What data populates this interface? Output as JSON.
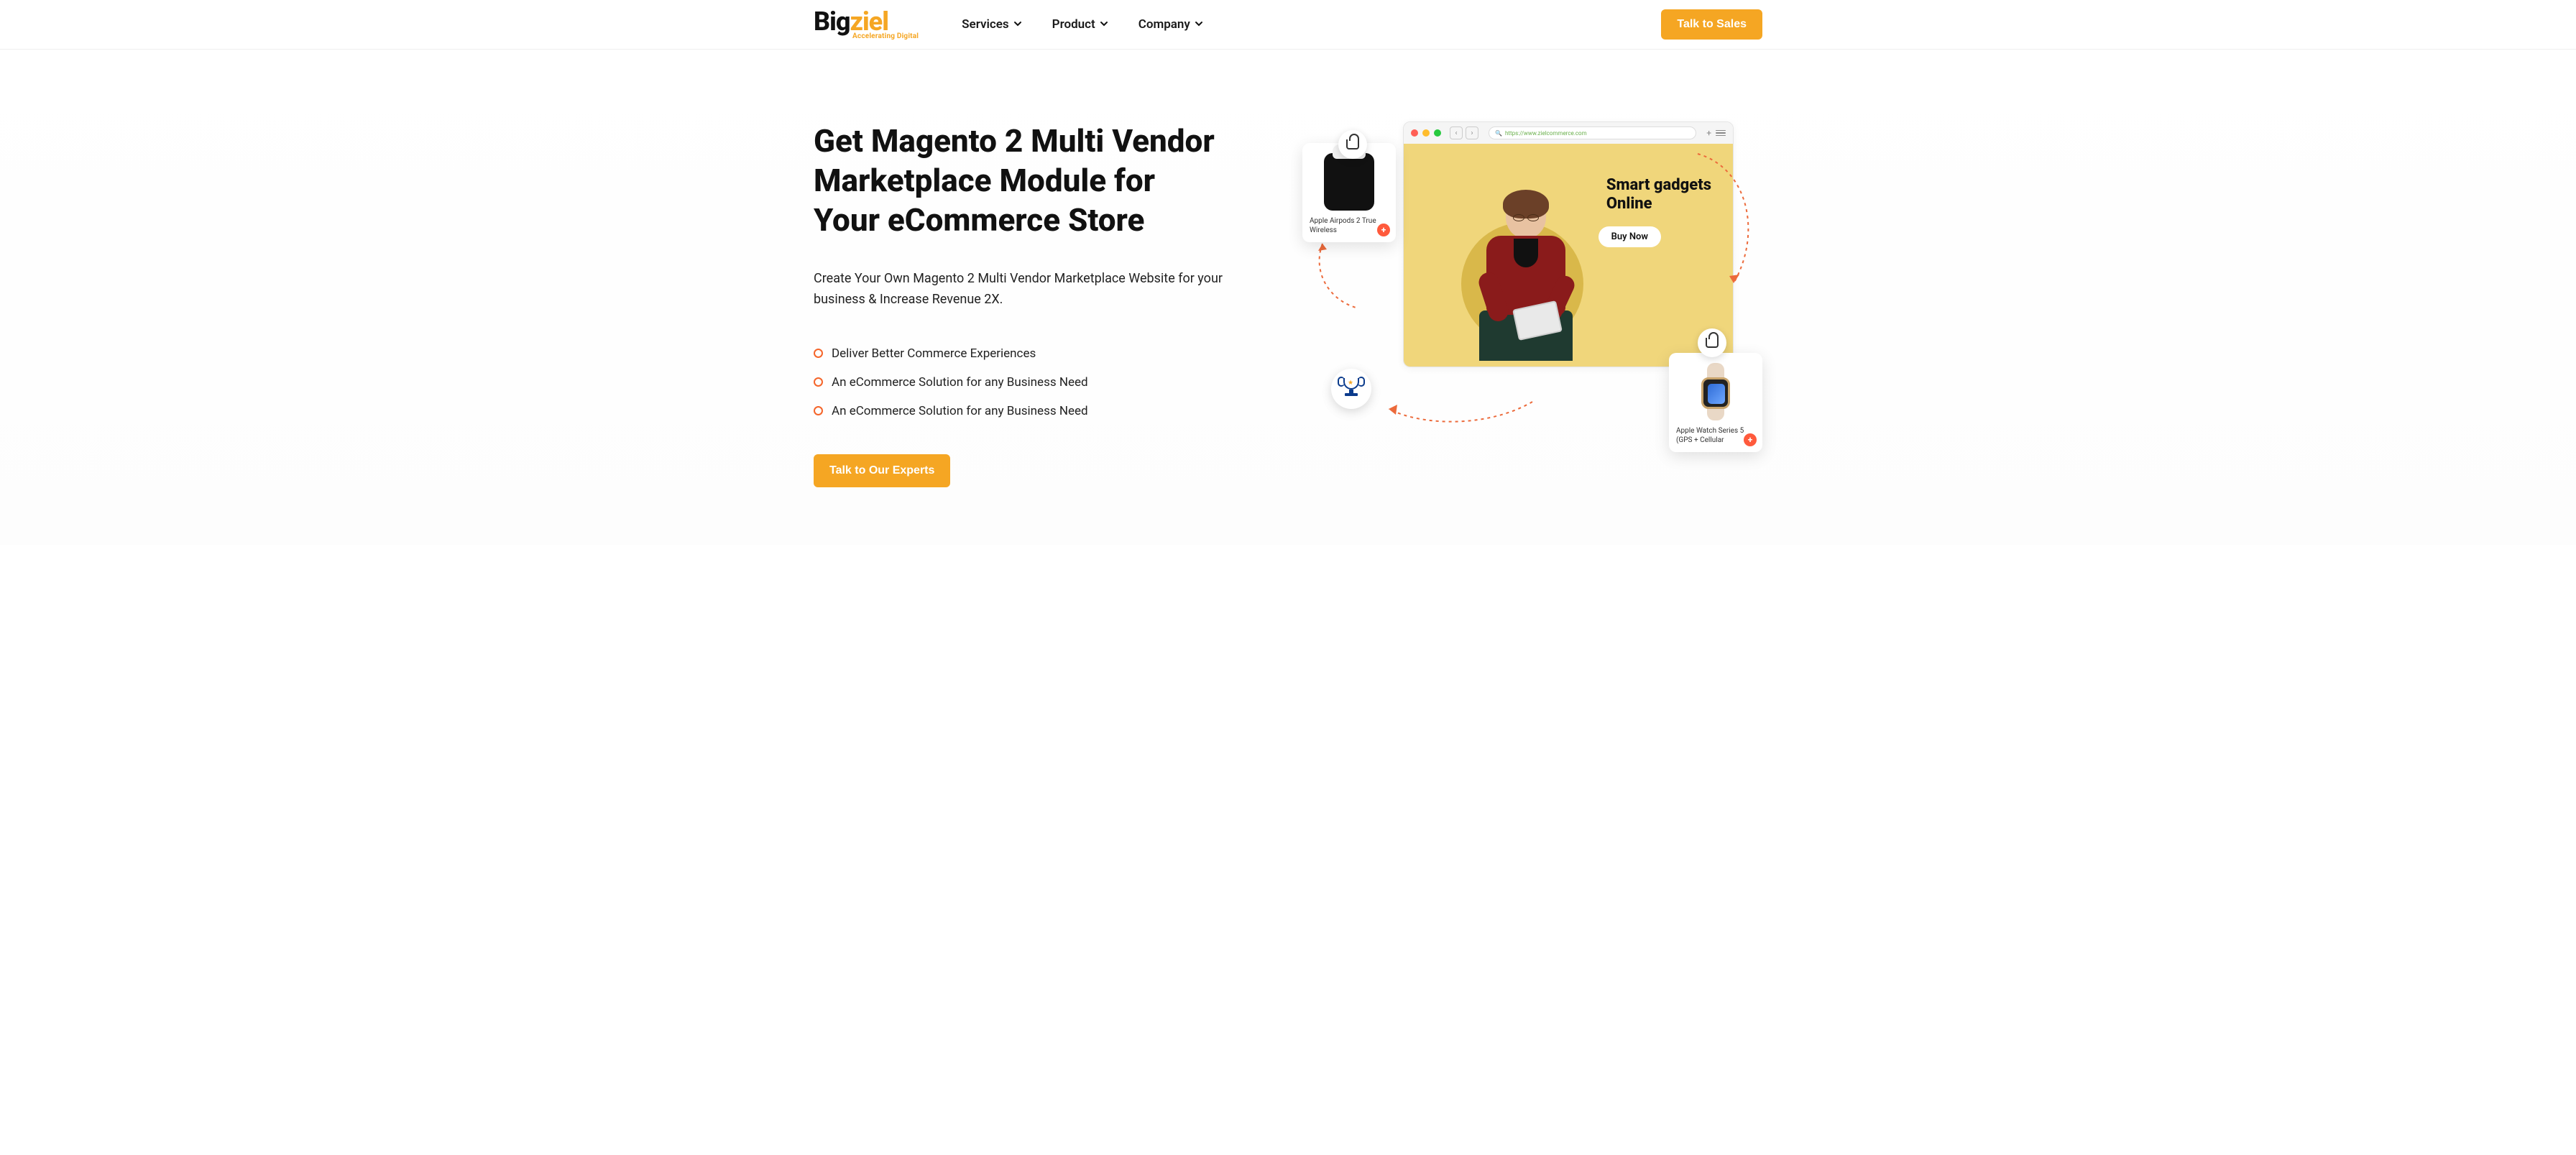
{
  "brand": {
    "name_part1": "B",
    "name_part2": "i",
    "name_part3": "g",
    "name_part4": "ziel",
    "tagline": "Accelerating Digital"
  },
  "nav": {
    "items": [
      {
        "label": "Services"
      },
      {
        "label": "Product"
      },
      {
        "label": "Company"
      }
    ],
    "cta": "Talk to Sales"
  },
  "hero": {
    "title_line1": "Get Magento 2 Multi Vendor",
    "title_line2": "Marketplace Module for",
    "title_line3": "Your eCommerce Store",
    "subtitle": "Create Your Own Magento 2 Multi Vendor Marketplace Website for your business & Increase Revenue 2X.",
    "features": [
      "Deliver Better Commerce Experiences",
      "An eCommerce Solution for any Business Need",
      "An eCommerce Solution for any Business Need"
    ],
    "cta": "Talk to Our Experts"
  },
  "illustration": {
    "browser_url": "https://www.zielcommerce.com",
    "banner_line1": "Smart gadgets",
    "banner_line2": "Online",
    "buy_now": "Buy Now",
    "product1": {
      "name": "Apple Airpods 2 True Wireless"
    },
    "product2": {
      "name": "Apple Watch Series 5 (GPS + Cellular"
    }
  },
  "colors": {
    "accent": "#f5a623",
    "bullet": "#f5652a"
  }
}
